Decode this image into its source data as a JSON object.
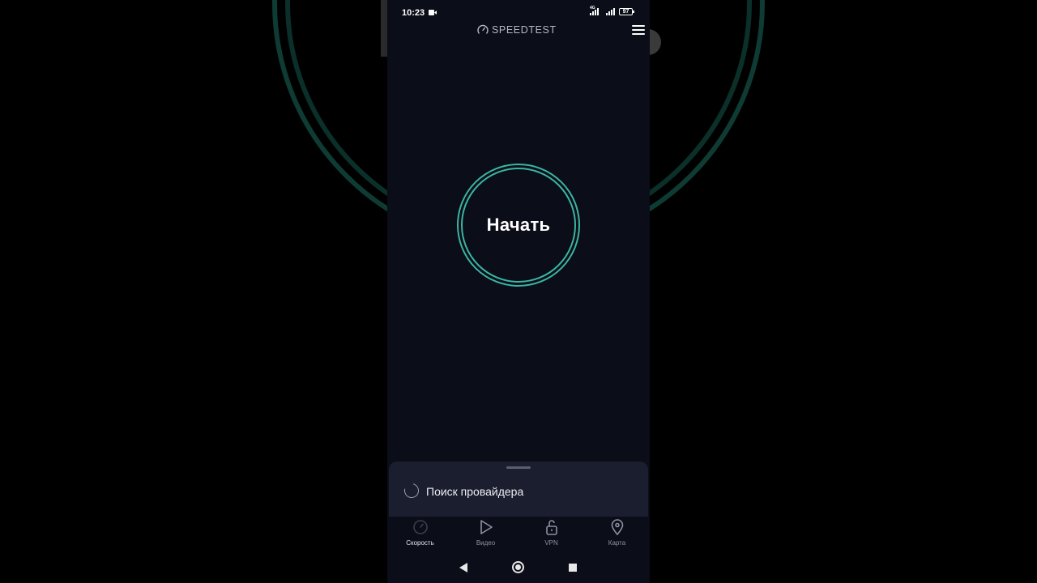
{
  "status_bar": {
    "time": "10:23",
    "network_tag": "4G",
    "battery_level": "97",
    "icons": [
      "video-record-icon",
      "signal-icon",
      "signal-icon",
      "battery-icon"
    ]
  },
  "header": {
    "brand": "SPEEDTEST",
    "brand_icon": "gauge-icon",
    "menu_icon": "hamburger-menu-icon"
  },
  "main": {
    "go_button_label": "Начать"
  },
  "sheet": {
    "status_text": "Поиск провайдера"
  },
  "tabs": [
    {
      "label": "Скорость",
      "icon": "speedometer-icon",
      "active": true
    },
    {
      "label": "Видео",
      "icon": "play-icon",
      "active": false
    },
    {
      "label": "VPN",
      "icon": "unlock-icon",
      "active": false
    },
    {
      "label": "Карта",
      "icon": "map-pin-icon",
      "active": false
    }
  ],
  "system_nav": [
    "back-icon",
    "home-icon",
    "recents-icon"
  ],
  "colors": {
    "background": "#0b0d18",
    "accent": "#3ab5a3",
    "sheet": "#1b1e2e"
  }
}
